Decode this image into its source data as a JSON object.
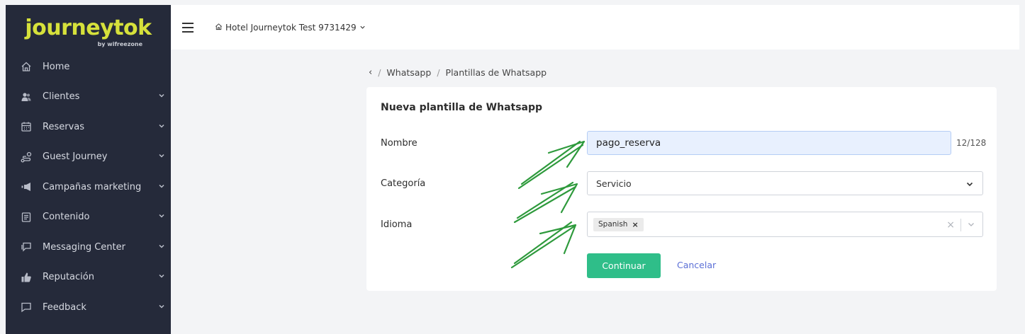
{
  "sidebar": {
    "logo": "journeytok",
    "logo_sub": "by wifreezone",
    "items": [
      {
        "label": "Home",
        "icon": "home-icon",
        "has_chevron": false
      },
      {
        "label": "Clientes",
        "icon": "users-icon",
        "has_chevron": true
      },
      {
        "label": "Reservas",
        "icon": "calendar-icon",
        "has_chevron": true
      },
      {
        "label": "Guest Journey",
        "icon": "route-icon",
        "has_chevron": true
      },
      {
        "label": "Campañas marketing",
        "icon": "megaphone-icon",
        "has_chevron": true
      },
      {
        "label": "Contenido",
        "icon": "document-icon",
        "has_chevron": true
      },
      {
        "label": "Messaging Center",
        "icon": "chat-icon",
        "has_chevron": true
      },
      {
        "label": "Reputación",
        "icon": "thumbs-up-icon",
        "has_chevron": true
      },
      {
        "label": "Feedback",
        "icon": "feedback-icon",
        "has_chevron": true
      }
    ]
  },
  "topbar": {
    "hotel": "Hotel Journeytok Test 9731429"
  },
  "breadcrumb": {
    "items": [
      "Whatsapp",
      "Plantillas de Whatsapp"
    ]
  },
  "form": {
    "title": "Nueva plantilla de Whatsapp",
    "name_label": "Nombre",
    "name_value": "pago_reserva",
    "name_counter": "12/128",
    "category_label": "Categoría",
    "category_value": "Servicio",
    "language_label": "Idioma",
    "language_chip": "Spanish",
    "submit_label": "Continuar",
    "cancel_label": "Cancelar"
  },
  "colors": {
    "sidebar_bg": "#252a3a",
    "logo": "#d6e13b",
    "primary": "#2fbe89",
    "link": "#5b6fd6",
    "annotation": "#2e9a3c"
  }
}
